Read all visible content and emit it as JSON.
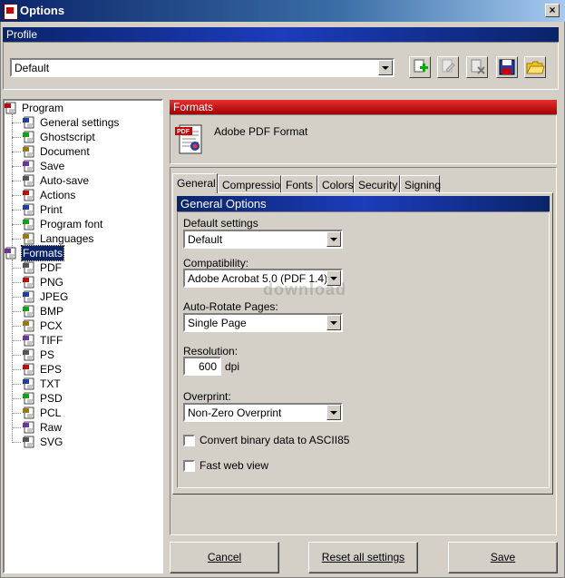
{
  "window": {
    "title": "Options",
    "close_label": "×"
  },
  "profile": {
    "header": "Profile",
    "selected": "Default",
    "toolbar_icons": [
      "add-profile-icon",
      "rename-profile-icon",
      "delete-profile-icon",
      "save-profile-icon",
      "open-profile-icon"
    ]
  },
  "tree": {
    "items": [
      {
        "label": "Program",
        "icon": "program-icon",
        "level": 0
      },
      {
        "label": "General settings",
        "icon": "general-settings-icon",
        "level": 1
      },
      {
        "label": "Ghostscript",
        "icon": "ghostscript-icon",
        "level": 1
      },
      {
        "label": "Document",
        "icon": "document-icon",
        "level": 1
      },
      {
        "label": "Save",
        "icon": "save-icon",
        "level": 1
      },
      {
        "label": "Auto-save",
        "icon": "auto-save-icon",
        "level": 1
      },
      {
        "label": "Actions",
        "icon": "actions-icon",
        "level": 1
      },
      {
        "label": "Print",
        "icon": "print-icon",
        "level": 1
      },
      {
        "label": "Program font",
        "icon": "font-icon",
        "level": 1
      },
      {
        "label": "Languages",
        "icon": "languages-icon",
        "level": 1
      },
      {
        "label": "Formats",
        "icon": "formats-icon",
        "level": 0,
        "selected": true
      },
      {
        "label": "PDF",
        "icon": "pdf-icon",
        "level": 1
      },
      {
        "label": "PNG",
        "icon": "png-icon",
        "level": 1
      },
      {
        "label": "JPEG",
        "icon": "jpeg-icon",
        "level": 1
      },
      {
        "label": "BMP",
        "icon": "bmp-icon",
        "level": 1
      },
      {
        "label": "PCX",
        "icon": "pcx-icon",
        "level": 1
      },
      {
        "label": "TIFF",
        "icon": "tiff-icon",
        "level": 1
      },
      {
        "label": "PS",
        "icon": "ps-icon",
        "level": 1
      },
      {
        "label": "EPS",
        "icon": "eps-icon",
        "level": 1
      },
      {
        "label": "TXT",
        "icon": "txt-icon",
        "level": 1
      },
      {
        "label": "PSD",
        "icon": "psd-icon",
        "level": 1
      },
      {
        "label": "PCL",
        "icon": "pcl-icon",
        "level": 1
      },
      {
        "label": "Raw",
        "icon": "raw-icon",
        "level": 1
      },
      {
        "label": "SVG",
        "icon": "svg-icon",
        "level": 1
      }
    ]
  },
  "formats": {
    "header": "Formats",
    "format_name": "Adobe PDF Format"
  },
  "tabs": [
    "General",
    "Compression",
    "Fonts",
    "Colors",
    "Security",
    "Signing"
  ],
  "general": {
    "header": "General Options",
    "default_settings_label": "Default settings",
    "default_settings_value": "Default",
    "compatibility_label": "Compatibility:",
    "compatibility_value": "Adobe Acrobat 5.0 (PDF 1.4)",
    "autorotate_label": "Auto-Rotate Pages:",
    "autorotate_value": "Single Page",
    "resolution_label": "Resolution:",
    "resolution_value": "600",
    "resolution_unit": "dpi",
    "overprint_label": "Overprint:",
    "overprint_value": "Non-Zero Overprint",
    "ascii85_label": "Convert binary data to ASCII85",
    "ascii85_checked": false,
    "fastweb_label": "Fast web view",
    "fastweb_checked": false
  },
  "watermark": "download",
  "buttons": {
    "cancel": "Cancel",
    "reset": "Reset all settings",
    "save": "Save"
  },
  "colors": {
    "title_blue": "#0a246a",
    "formats_red": "#c00000",
    "face": "#d4d0c8"
  }
}
